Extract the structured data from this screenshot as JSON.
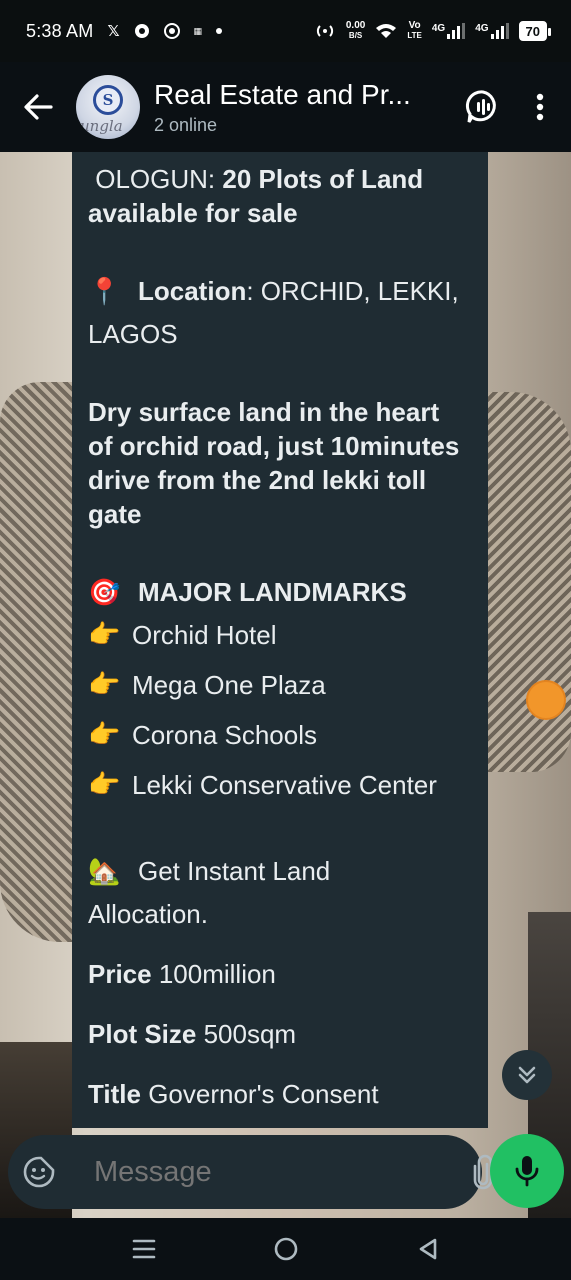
{
  "status_bar": {
    "time": "5:38 AM",
    "net_speed_value": "0.00",
    "net_speed_unit": "B/S",
    "volte_top": "Vo",
    "volte_bottom": "LTE",
    "sim1_tech": "4G",
    "sim2_tech": "4G",
    "battery": "70"
  },
  "header": {
    "avatar_letter": "S",
    "avatar_text": "ungla",
    "title": "Real Estate and Pr...",
    "subtitle": "2 online"
  },
  "message": {
    "line1_plain": " OLOGUN: ",
    "line1_bold": "20 Plots of Land",
    "line2_bold": "available for sale",
    "location_pin": "📍",
    "location_label": "Location",
    "location_value": ": ORCHID, LEKKI,",
    "location_value2": "LAGOS",
    "desc_lines": [
      "Dry surface land in the heart",
      "of orchid road, just 10minutes",
      "drive from the 2nd lekki toll",
      "gate"
    ],
    "landmarks_icon": "🎯",
    "landmarks_heading": "MAJOR LANDMARKS",
    "landmark_hand": "👉",
    "landmarks": [
      "Orchid Hotel",
      "Mega One Plaza",
      "Corona Schools",
      "Lekki Conservative Center"
    ],
    "allocation_icon": "🏡",
    "allocation_line1": "Get Instant Land",
    "allocation_line2": "Allocation.",
    "price_label": "Price",
    "price_value": " 100million",
    "plot_label": "Plot Size",
    "plot_value": " 500sqm",
    "title_label": "Title",
    "title_value": " Governor's Consent"
  },
  "composer": {
    "placeholder": "Message"
  },
  "colors": {
    "accent_green": "#21c063",
    "bubble": "#1f2c33",
    "orange": "#f2962a"
  }
}
